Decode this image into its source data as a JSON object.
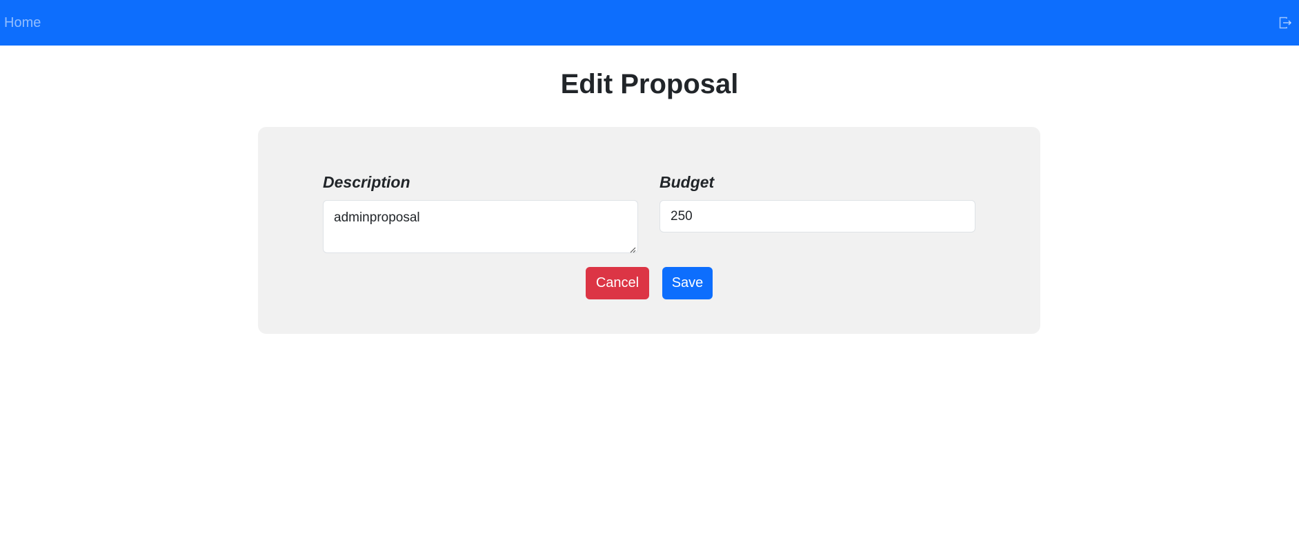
{
  "navbar": {
    "home_label": "Home",
    "logout_icon": "logout-icon",
    "background_color": "#0d6efd"
  },
  "page": {
    "title": "Edit Proposal"
  },
  "form": {
    "description": {
      "label": "Description",
      "value": "adminproposal"
    },
    "budget": {
      "label": "Budget",
      "value": "250"
    },
    "cancel_label": "Cancel",
    "save_label": "Save",
    "cancel_color": "#dc3545",
    "save_color": "#0d6efd"
  }
}
